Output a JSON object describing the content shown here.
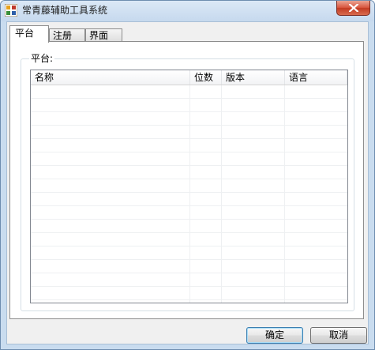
{
  "window": {
    "title": "常青藤辅助工具系统",
    "app_icon": "grid-app-icon",
    "close_icon": "close-icon",
    "close_button_color": "#c9452c"
  },
  "tabs": [
    {
      "label": "平台",
      "active": true
    },
    {
      "label": "注册",
      "active": false
    },
    {
      "label": "界面",
      "active": false
    }
  ],
  "platform_panel": {
    "group_label": "平台:",
    "list": {
      "columns": [
        "名称",
        "位数",
        "版本",
        "语言"
      ],
      "rows": []
    }
  },
  "buttons": {
    "ok_label": "确定",
    "cancel_label": "取消"
  }
}
